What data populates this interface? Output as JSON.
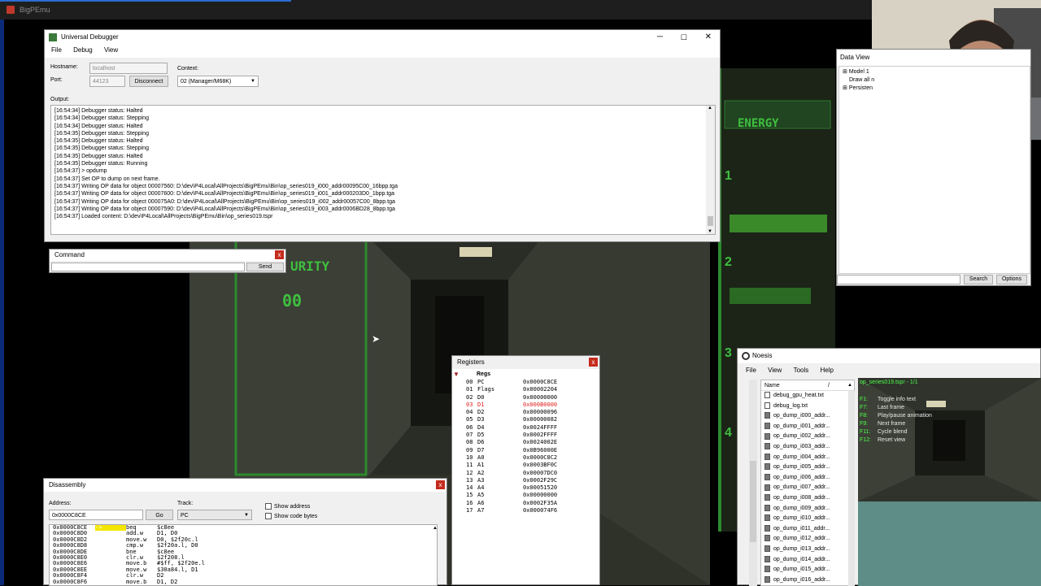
{
  "host": {
    "title": "BigPEmu"
  },
  "game_hud": {
    "security_text": "URITY",
    "security_value": "00",
    "energy_label": "ENERGY",
    "slot1": "1",
    "slot2": "2",
    "slot3": "3",
    "slot4": "4"
  },
  "debugger": {
    "title": "Universal Debugger",
    "menu": [
      "File",
      "Debug",
      "View"
    ],
    "hostname_label": "Hostname:",
    "hostname_value": "localhost",
    "port_label": "Port:",
    "port_value": "44123",
    "disconnect_label": "Disconnect",
    "context_label": "Context:",
    "context_value": "02 (Manager/M68K)",
    "output_label": "Output:",
    "output_lines": [
      "[16:54:34]  Debugger status: Halted",
      "[16:54:34]  Debugger status: Stepping",
      "[16:54:34]  Debugger status: Halted",
      "[16:54:35]  Debugger status: Stepping",
      "[16:54:35]  Debugger status: Halted",
      "[16:54:35]  Debugger status: Stepping",
      "[16:54:35]  Debugger status: Halted",
      "[16:54:35]  Debugger status: Running",
      "[16:54:37]  > opdump",
      "[16:54:37]  Set OP to dump on next frame.",
      "[16:54:37]  Writing OP data for object 00007560: D:\\dev\\P4Local\\AllProjects\\BigPEmu\\Bin\\op_series019_i000_addr00095C00_16bpp.tga",
      "[16:54:37]  Writing OP data for object 00007600: D:\\dev\\P4Local\\AllProjects\\BigPEmu\\Bin\\op_series019_i001_addr000203D0_1bpp.tga",
      "[16:54:37]  Writing OP data for object 000075A0: D:\\dev\\P4Local\\AllProjects\\BigPEmu\\Bin\\op_series019_i002_addr00057C00_8bpp.tga",
      "[16:54:37]  Writing OP data for object 00007590: D:\\dev\\P4Local\\AllProjects\\BigPEmu\\Bin\\op_series019_i003_addr0006BD28_8bpp.tga",
      "[16:54:37]  Loaded content: D:\\dev\\P4Local\\AllProjects\\BigPEmu\\Bin\\op_series019.tspr"
    ]
  },
  "command": {
    "title": "Command",
    "send_label": "Send",
    "input_value": ""
  },
  "disassembly": {
    "title": "Disassembly",
    "address_label": "Address:",
    "address_value": "0x0000C8CE",
    "go_label": "Go",
    "track_label": "Track:",
    "track_value": "PC",
    "show_address": "Show address",
    "show_code_bytes": "Show code bytes",
    "rows": [
      {
        "addr": "0x0000C8CE",
        "mark": "->",
        "op": "beq",
        "args": "$c8ee"
      },
      {
        "addr": "0x0000C8D0",
        "mark": "",
        "op": "add.w",
        "args": "D1, D0"
      },
      {
        "addr": "0x0000C8D2",
        "mark": "",
        "op": "move.w",
        "args": "D0, $2f20c.l"
      },
      {
        "addr": "0x0000C8D8",
        "mark": "",
        "op": "cmp.w",
        "args": "$2f20a.l, D0"
      },
      {
        "addr": "0x0000C8DE",
        "mark": "",
        "op": "bne",
        "args": "$c8ee"
      },
      {
        "addr": "0x0000C8E0",
        "mark": "",
        "op": "clr.w",
        "args": "$2f208.l"
      },
      {
        "addr": "0x0000C8E6",
        "mark": "",
        "op": "move.b",
        "args": "#$ff, $2f20e.l"
      },
      {
        "addr": "0x0000C8EE",
        "mark": "",
        "op": "move.w",
        "args": "$30a84.l, D1"
      },
      {
        "addr": "0x0000C8F4",
        "mark": "",
        "op": "clr.w",
        "args": "D2"
      },
      {
        "addr": "0x0000C8F6",
        "mark": "",
        "op": "move.b",
        "args": "D1, D2"
      }
    ]
  },
  "registers": {
    "title": "Registers",
    "group": "Regs",
    "rows": [
      {
        "idx": "00",
        "name": "PC",
        "value": "0x0000C8CE",
        "changed": false
      },
      {
        "idx": "01",
        "name": "Flags",
        "value": "0x00002204",
        "changed": false
      },
      {
        "idx": "02",
        "name": "D0",
        "value": "0x00000000",
        "changed": false
      },
      {
        "idx": "03",
        "name": "D1",
        "value": "0x000B0000",
        "changed": true
      },
      {
        "idx": "04",
        "name": "D2",
        "value": "0x00000096",
        "changed": false
      },
      {
        "idx": "05",
        "name": "D3",
        "value": "0x00000082",
        "changed": false
      },
      {
        "idx": "06",
        "name": "D4",
        "value": "0x0024FFFF",
        "changed": false
      },
      {
        "idx": "07",
        "name": "D5",
        "value": "0x0002FFFF",
        "changed": false
      },
      {
        "idx": "08",
        "name": "D6",
        "value": "0x0024002E",
        "changed": false
      },
      {
        "idx": "09",
        "name": "D7",
        "value": "0x0B96000E",
        "changed": false
      },
      {
        "idx": "10",
        "name": "A0",
        "value": "0x0000C8C2",
        "changed": false
      },
      {
        "idx": "11",
        "name": "A1",
        "value": "0x0003BF0C",
        "changed": false
      },
      {
        "idx": "12",
        "name": "A2",
        "value": "0x00007DC0",
        "changed": false
      },
      {
        "idx": "13",
        "name": "A3",
        "value": "0x0002F29C",
        "changed": false
      },
      {
        "idx": "14",
        "name": "A4",
        "value": "0x00051520",
        "changed": false
      },
      {
        "idx": "15",
        "name": "A5",
        "value": "0x00000000",
        "changed": false
      },
      {
        "idx": "16",
        "name": "A6",
        "value": "0x0002F35A",
        "changed": false
      },
      {
        "idx": "17",
        "name": "A7",
        "value": "0x000074F6",
        "changed": false
      }
    ]
  },
  "data_viewer": {
    "title": "Data View",
    "tree": [
      "Model 1",
      "Draw all n",
      "Persisten"
    ],
    "search_label": "Search",
    "options_label": "Options"
  },
  "noesis": {
    "title": "Noesis",
    "menu": [
      "File",
      "View",
      "Tools",
      "Help"
    ],
    "column_name": "Name",
    "column_sep": "/",
    "files": [
      "debug_gpu_heat.txt",
      "debug_log.txt",
      "op_dump_i000_addr...",
      "op_dump_i001_addr...",
      "op_dump_i002_addr...",
      "op_dump_i003_addr...",
      "op_dump_i004_addr...",
      "op_dump_i005_addr...",
      "op_dump_i006_addr...",
      "op_dump_i007_addr...",
      "op_dump_i008_addr...",
      "op_dump_i009_addr...",
      "op_dump_i010_addr...",
      "op_dump_i011_addr...",
      "op_dump_i012_addr...",
      "op_dump_i013_addr...",
      "op_dump_i014_addr...",
      "op_dump_i015_addr...",
      "op_dump_i016_addr..."
    ],
    "preview_title": "op_series019.tspr - 1/1",
    "keys": [
      {
        "key": "F1:",
        "desc": "Toggle info text"
      },
      {
        "key": "F7:",
        "desc": "Last frame"
      },
      {
        "key": "F8:",
        "desc": "Play/pause animation"
      },
      {
        "key": "F9:",
        "desc": "Next frame"
      },
      {
        "key": "F11:",
        "desc": "Cycle blend"
      },
      {
        "key": "F12:",
        "desc": "Reset view"
      }
    ]
  },
  "colors": {
    "accent": "#2b6cd1",
    "hud_green": "#3fbf3f",
    "noesis_text": "#4cff4c",
    "register_changed": "#e02020"
  }
}
